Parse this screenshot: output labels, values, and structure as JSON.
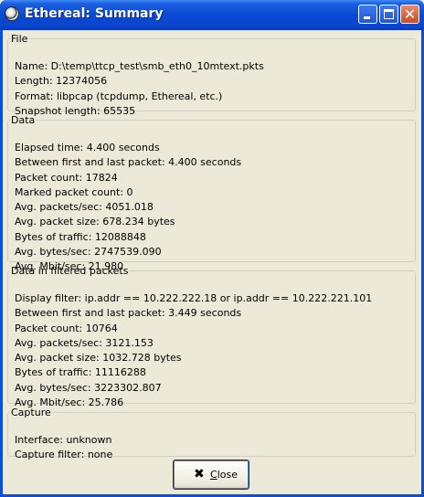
{
  "window": {
    "title": "Ethereal: Summary"
  },
  "file": {
    "legend": "File",
    "lines": [
      "Name: D:\\temp\\ttcp_test\\smb_eth0_10mtext.pkts",
      "Length: 12374056",
      "Format: libpcap (tcpdump, Ethereal, etc.)",
      "Snapshot length: 65535"
    ]
  },
  "data": {
    "legend": "Data",
    "lines": [
      "Elapsed time: 4.400 seconds",
      "Between first and last packet: 4.400 seconds",
      "Packet count: 17824",
      "Marked packet count: 0",
      "Avg. packets/sec: 4051.018",
      "Avg. packet size: 678.234 bytes",
      "Bytes of traffic: 12088848",
      "Avg. bytes/sec: 2747539.090",
      "Avg. Mbit/sec: 21.980"
    ]
  },
  "filtered": {
    "legend": "Data in filtered packets",
    "lines": [
      "Display filter: ip.addr == 10.222.222.18 or ip.addr == 10.222.221.101",
      "Between first and last packet: 3.449 seconds",
      "Packet count: 10764",
      "Avg. packets/sec: 3121.153",
      "Avg. packet size: 1032.728 bytes",
      "Bytes of traffic: 11116288",
      "Avg. bytes/sec: 3223302.807",
      "Avg. Mbit/sec: 25.786"
    ]
  },
  "capture": {
    "legend": "Capture",
    "lines": [
      "Interface: unknown",
      "Capture filter: none"
    ]
  },
  "buttons": {
    "close_mnemonic": "C",
    "close_rest": "lose"
  },
  "icons": {
    "app": "ethereal-app-icon",
    "close_button_icon": "x-icon"
  }
}
